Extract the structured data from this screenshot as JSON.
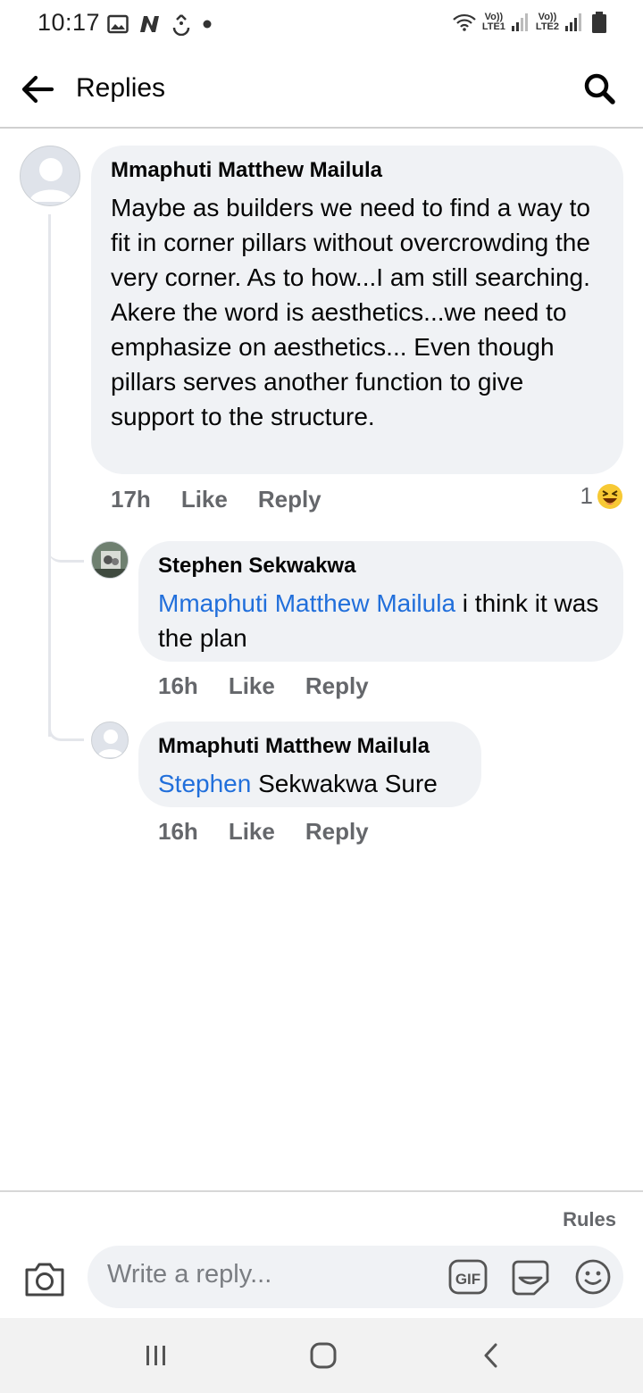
{
  "status_bar": {
    "time": "10:17",
    "left_icons": [
      "image-icon",
      "n-icon",
      "sync-icon",
      "dot-icon"
    ],
    "right_icons": [
      "wifi-icon",
      "signal-lte1-icon",
      "signal-lte2-icon",
      "battery-icon"
    ],
    "sim1_label_top": "Vo))",
    "sim1_label_bottom": "LTE1",
    "sim2_label_top": "Vo))",
    "sim2_label_bottom": "LTE2"
  },
  "header": {
    "title": "Replies",
    "back_icon": "arrow-left-icon",
    "search_icon": "search-icon"
  },
  "comments": [
    {
      "author": "Mmaphuti Matthew Mailula",
      "text": "Maybe as builders we need to find a way to fit in corner pillars without overcrowding the very corner. As to how...I am still searching. Akere the word is aesthetics...we need to emphasize on aesthetics... Even though pillars serves another function to give support to the structure.",
      "time": "17h",
      "like": "Like",
      "reply": "Reply",
      "reaction_count": "1",
      "reaction_icon": "laughing-emoji-icon"
    },
    {
      "author": "Stephen Sekwakwa",
      "mention": "Mmaphuti Matthew Mailula",
      "text": " i think it was the plan",
      "time": "16h",
      "like": "Like",
      "reply": "Reply"
    },
    {
      "author": "Mmaphuti Matthew Mailula",
      "mention": "Stephen",
      "text": " Sekwakwa Sure",
      "time": "16h",
      "like": "Like",
      "reply": "Reply"
    }
  ],
  "composer": {
    "rules": "Rules",
    "placeholder": "Write a reply...",
    "gif_label": "GIF",
    "icons": [
      "camera-icon",
      "gif-icon",
      "sticker-icon",
      "emoji-icon"
    ]
  },
  "nav_bar": {
    "icons": [
      "recent-apps-icon",
      "home-icon",
      "back-nav-icon"
    ]
  },
  "colors": {
    "bubble": "#f0f2f5",
    "mention": "#216fdb",
    "secondary_text": "#65676b",
    "thread_line": "#e4e6eb"
  }
}
